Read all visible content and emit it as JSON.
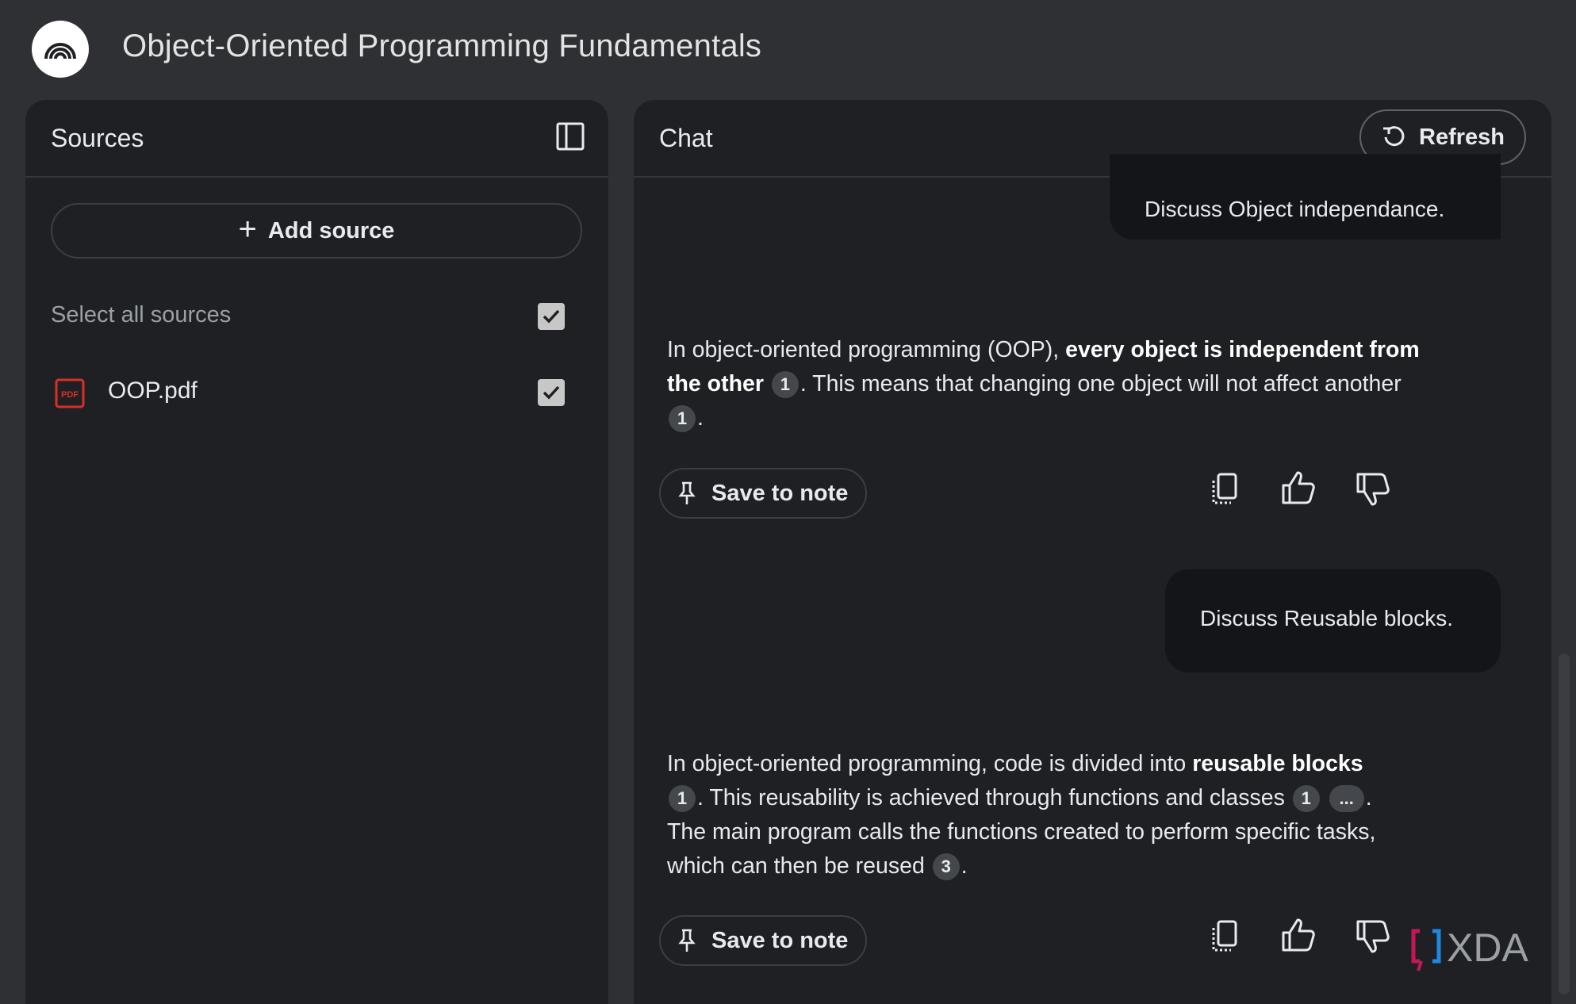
{
  "app": {
    "title": "Object-Oriented Programming Fundamentals",
    "logo_icon": "notebooklm-logo-icon"
  },
  "sources": {
    "title": "Sources",
    "add_source_label": "Add source",
    "select_all_label": "Select all sources",
    "select_all_checked": true,
    "files": [
      {
        "name": "OOP.pdf",
        "icon": "pdf-icon",
        "checked": true
      }
    ]
  },
  "chat": {
    "title": "Chat",
    "refresh_label": "Refresh",
    "messages": [
      {
        "role": "user",
        "text": "Discuss Object independance."
      },
      {
        "role": "assistant",
        "parts": [
          "In object-oriented programming (OOP), ",
          "every object is independent from the other",
          "1",
          ". This means that changing one object will not affect another",
          "1",
          "."
        ],
        "save_label": "Save to note"
      },
      {
        "role": "user",
        "text": "Discuss Reusable blocks."
      },
      {
        "role": "assistant",
        "parts": [
          "In object-oriented programming, code is divided into ",
          "reusable blocks",
          "1",
          ". This reusability is achieved through functions and classes",
          "1",
          "...",
          ".",
          "The main program calls the functions created to perform specific tasks, which can then be reused",
          "3",
          "."
        ],
        "save_label": "Save to note"
      }
    ]
  },
  "watermark": {
    "text": "XDA"
  },
  "colors": {
    "background": "#2f3034",
    "panel": "#1f2023",
    "bubble": "#141518",
    "citation": "#44474c",
    "pdf_red": "#d93025"
  }
}
